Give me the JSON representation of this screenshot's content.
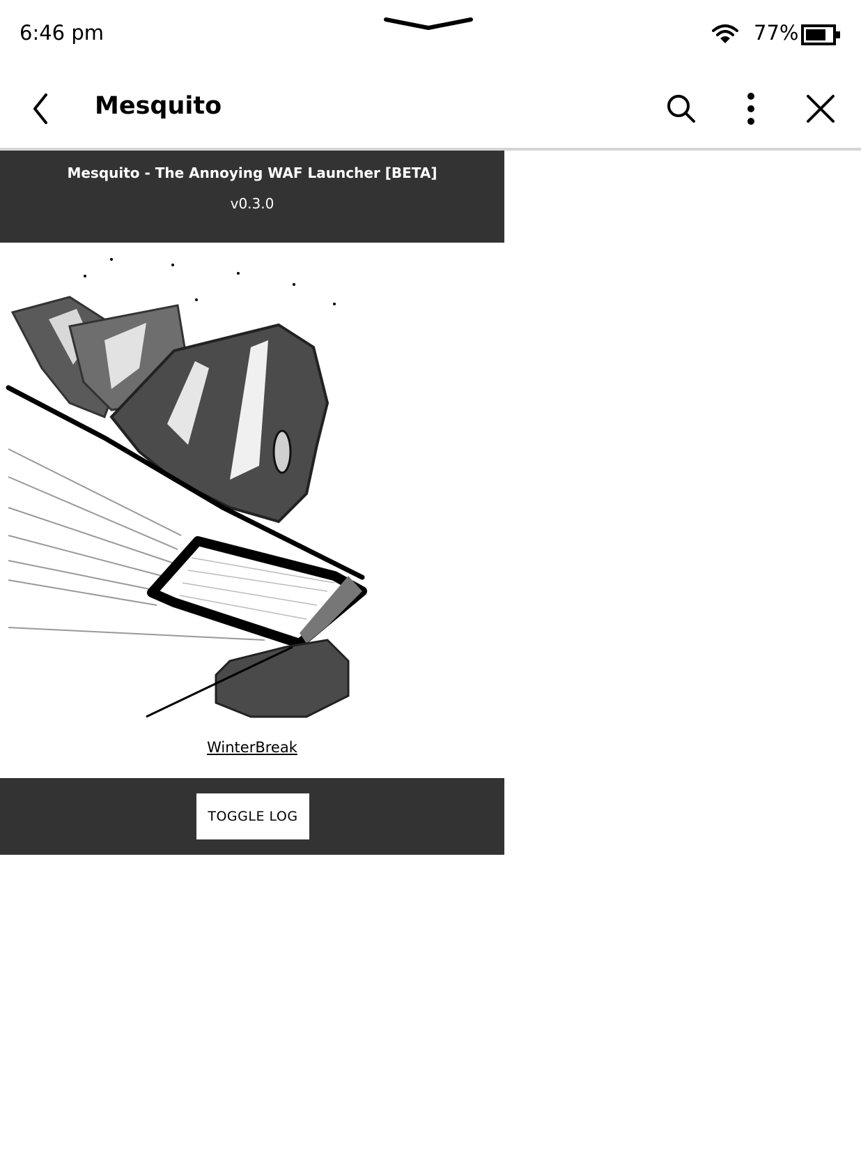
{
  "status_bar": {
    "time": "6:46 pm",
    "battery_percent": "77%",
    "battery_level": 0.77,
    "icons": [
      "pull-down-handle-icon",
      "wifi-icon",
      "battery-icon"
    ]
  },
  "nav": {
    "title": "Mesquito",
    "icons": [
      "back-icon",
      "search-icon",
      "more-icon",
      "close-icon"
    ]
  },
  "app": {
    "title": "Mesquito - The Annoying WAF Launcher [BETA]",
    "version": "v0.3.0",
    "artwork": "mosquito-sketch-illustration",
    "link_label": "WinterBreak",
    "toggle_button_label": "TOGGLE LOG"
  },
  "colors": {
    "panel_dark": "#333333",
    "background": "#ffffff",
    "divider": "#d4d4d4"
  }
}
